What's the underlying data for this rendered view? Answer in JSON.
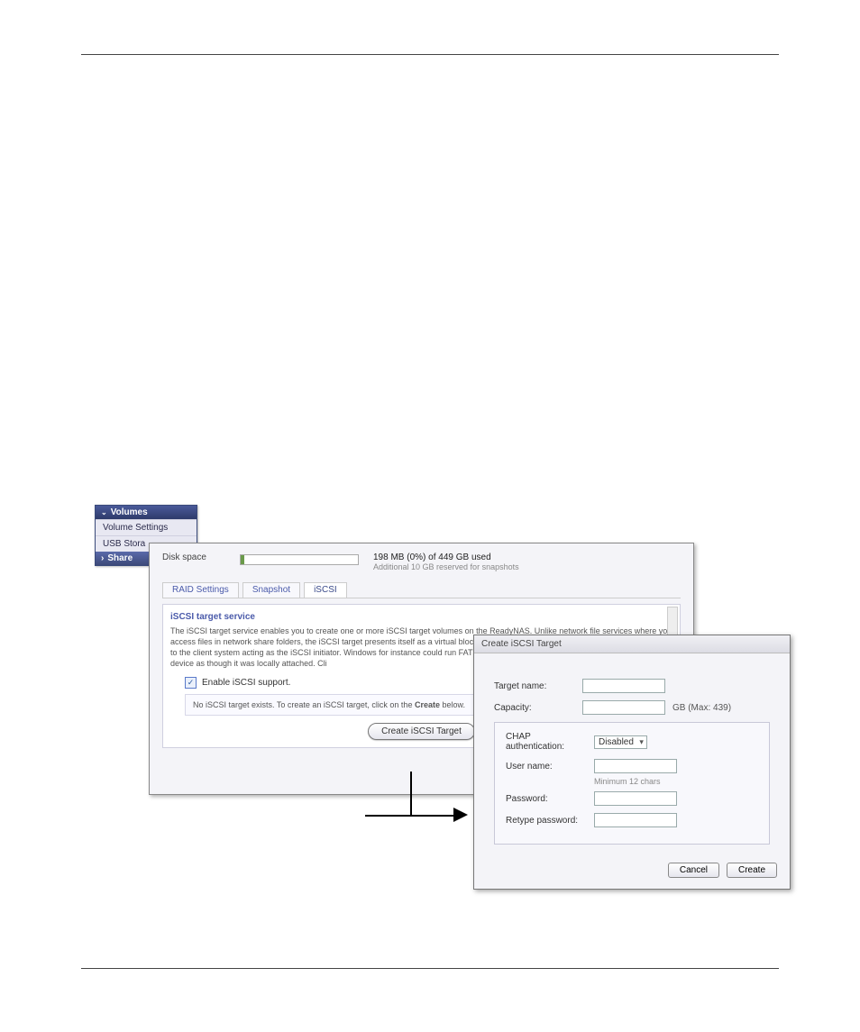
{
  "sidebar": {
    "header": "Volumes",
    "items": [
      "Volume Settings",
      "USB Stora"
    ],
    "selected": "Share"
  },
  "panel": {
    "disk_label": "Disk space",
    "disk_main": "198 MB (0%) of 449 GB used",
    "disk_sub": "Additional 10 GB reserved for snapshots",
    "tabs": {
      "raid": "RAID Settings",
      "snapshot": "Snapshot",
      "iscsi": "iSCSI"
    },
    "section_title": "iSCSI target service",
    "desc_html": "The iSCSI target service enables you to create one or more iSCSI target volumes on the ReadyNAS. Unlike network file services where you access files in network share folders, the iSCSI target presents itself as a virtual block device and can be treated like a locally attached disk to the client system acting as the iSCSI initiator. Windows for instance could run FAT32 or NTFS on the iSCSI target device, and treat the device as though it was locally attached. Cli",
    "enable_label": "Enable iSCSI support.",
    "notarget_pre": "No iSCSI target exists. To create an iSCSI target, click on the ",
    "notarget_bold": "Create",
    "notarget_post": " below.",
    "create_button": "Create iSCSI Target"
  },
  "dialog": {
    "title": "Create iSCSI Target",
    "target_name_label": "Target name:",
    "capacity_label": "Capacity:",
    "capacity_unit": "GB (Max: 439)",
    "chap_label": "CHAP authentication:",
    "chap_value": "Disabled",
    "user_label": "User name:",
    "min_chars": "Minimum 12 chars",
    "password_label": "Password:",
    "retype_label": "Retype password:",
    "cancel": "Cancel",
    "create": "Create"
  }
}
